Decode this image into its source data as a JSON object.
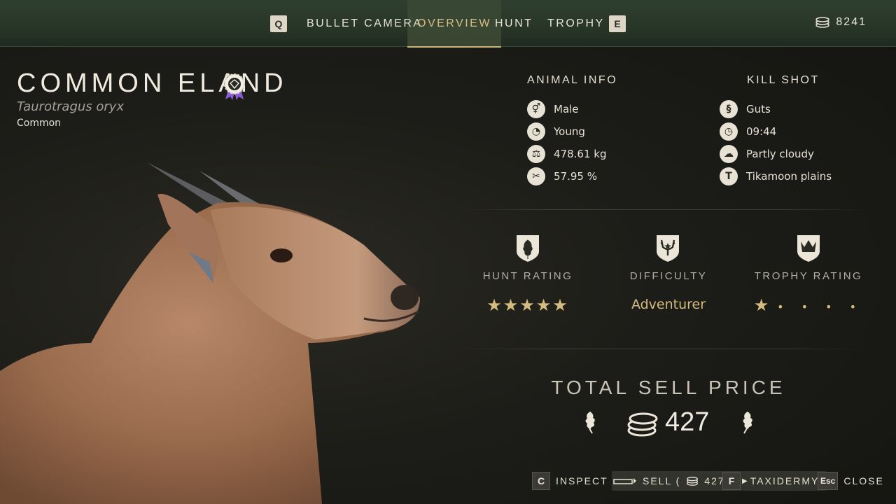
{
  "topbar": {
    "left_key": "Q",
    "right_key": "E",
    "tabs": [
      "BULLET CAMERA",
      "OVERVIEW",
      "HUNT",
      "TROPHY"
    ],
    "active_tab": "OVERVIEW",
    "money": "8241"
  },
  "animal": {
    "name": "COMMON ELAND",
    "latin": "Taurotragus oryx",
    "rarity": "Common"
  },
  "animal_info": {
    "heading": "ANIMAL INFO",
    "rows": [
      {
        "icon": "gender-icon",
        "value": "Male"
      },
      {
        "icon": "age-icon",
        "value": "Young"
      },
      {
        "icon": "weight-icon",
        "value": "478.61 kg"
      },
      {
        "icon": "integrity-icon",
        "value": "57.95 %"
      }
    ]
  },
  "kill_shot": {
    "heading": "KILL SHOT",
    "rows": [
      {
        "icon": "organ-icon",
        "value": "Guts"
      },
      {
        "icon": "clock-icon",
        "value": "09:44"
      },
      {
        "icon": "weather-icon",
        "value": "Partly cloudy"
      },
      {
        "icon": "location-icon",
        "value": "Tikamoon plains"
      }
    ]
  },
  "ratings": {
    "hunt": {
      "label": "HUNT RATING",
      "stars_filled": 5,
      "stars_total": 5
    },
    "difficulty": {
      "label": "DIFFICULTY",
      "value": "Adventurer"
    },
    "trophy": {
      "label": "TROPHY RATING",
      "stars_filled": 1,
      "stars_total": 5
    }
  },
  "sell": {
    "label": "TOTAL SELL PRICE",
    "value": "427"
  },
  "actions": [
    {
      "key": "C",
      "label": "INSPECT"
    },
    {
      "key": "",
      "label": "SELL (",
      "amount": "427",
      "close": ")"
    },
    {
      "key": "F",
      "label": "TAXIDERMY"
    },
    {
      "key": "Esc",
      "label": "CLOSE"
    }
  ],
  "colors": {
    "accent": "#d6bb7e",
    "topbar": "#2a382a",
    "background": "#1c1c18"
  }
}
